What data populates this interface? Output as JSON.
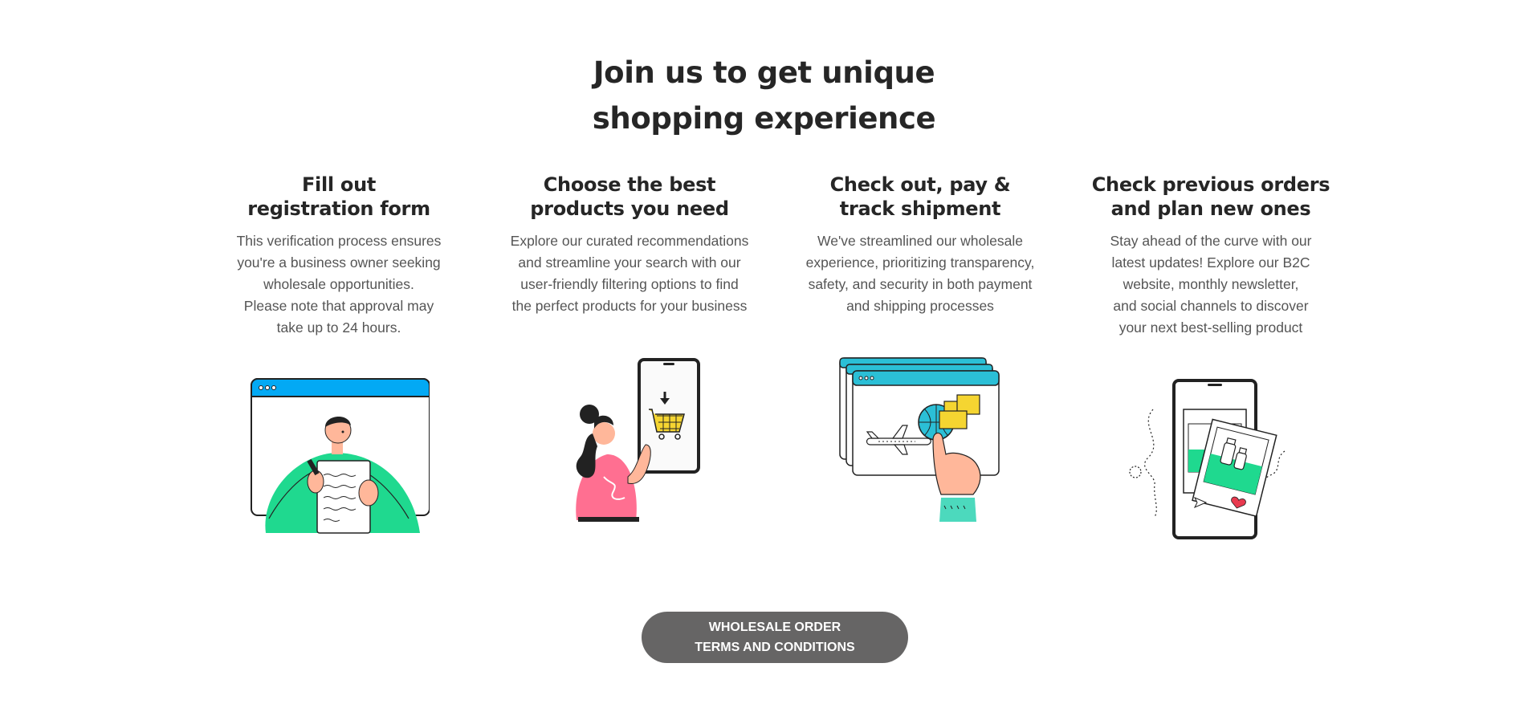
{
  "title": {
    "line1": "Join us to get unique",
    "line2": "shopping experience"
  },
  "steps": [
    {
      "heading": [
        "Fill out",
        "registration form"
      ],
      "text": [
        "This verification process ensures",
        "you're a business owner seeking",
        "wholesale opportunities.",
        "Please note that approval may",
        "take up to 24 hours."
      ],
      "icon": "registration-form-illustration"
    },
    {
      "heading": [
        "Choose the best",
        "products you need"
      ],
      "text": [
        "Explore our curated recommendations",
        "and streamline your search with our",
        "user-friendly filtering options to find",
        "the perfect products for your business"
      ],
      "icon": "product-selection-illustration"
    },
    {
      "heading": [
        "Check out, pay &",
        "track shipment"
      ],
      "text": [
        "We've streamlined our wholesale",
        "experience, prioritizing transparency,",
        "safety, and security in both payment",
        "and shipping processes"
      ],
      "icon": "shipment-tracking-illustration"
    },
    {
      "heading": [
        "Check previous orders",
        "and plan new ones"
      ],
      "text": [
        "Stay ahead of the curve with our",
        "latest updates! Explore our B2C",
        "website, monthly newsletter,",
        "and social channels to discover",
        "your next best-selling product"
      ],
      "icon": "order-history-illustration"
    }
  ],
  "cta": {
    "line1": "WHOLESALE ORDER",
    "line2": "TERMS AND CONDITIONS"
  },
  "colors": {
    "heading": "#262626",
    "body_text": "#555555",
    "button_bg": "#666565",
    "accent_blue": "#03a9f4",
    "accent_green": "#1fd98f",
    "accent_teal": "#2bbfd6",
    "accent_pink": "#ff6f91",
    "accent_yellow": "#f5d531"
  }
}
